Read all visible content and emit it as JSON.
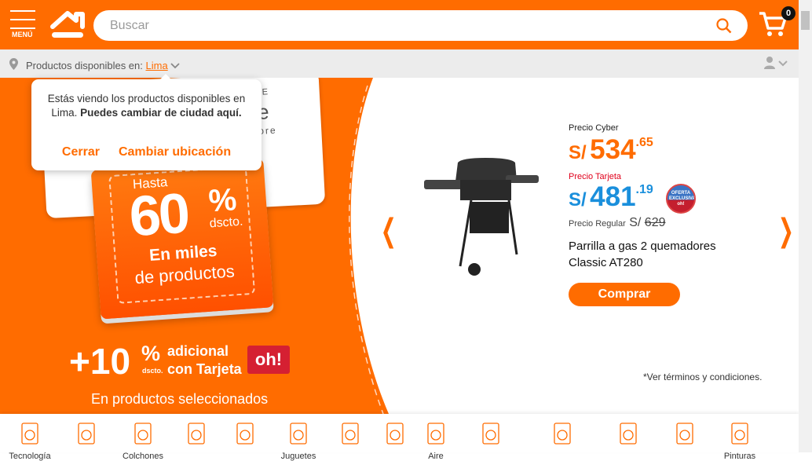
{
  "header": {
    "menu_label": "MENÚ",
    "search_placeholder": "Buscar",
    "cart_count": "0"
  },
  "location": {
    "label": "Productos disponibles en:",
    "city": "Lima"
  },
  "popup": {
    "message": "Estás viendo los productos disponibles en Lima.",
    "message_bold": "Puedes cambiar de ciudad aquí.",
    "close_label": "Cerrar",
    "change_label": "Cambiar ubicación"
  },
  "promo": {
    "hasta": "Hasta",
    "percent": "60",
    "percent_sign": "%",
    "dscto": "dscto.",
    "miles": "En miles",
    "productos": "de productos",
    "extra": "+10",
    "extra_sign": "%",
    "extra_dscto": "dscto.",
    "adicional": "adicional",
    "con_tarjeta": "con Tarjeta",
    "oh_logo": "oh!",
    "selected": "En productos seleccionados",
    "card_text_1": "N E",
    "card_text_2": "e",
    "card_text_3": "ore"
  },
  "product": {
    "cyber_label": "Precio Cyber",
    "cyber_currency": "S/",
    "cyber_int": "534",
    "cyber_dec": ".65",
    "card_label": "Precio Tarjeta",
    "card_currency": "S/",
    "card_int": "481",
    "card_dec": ".19",
    "badge": "OFERTA EXCLUSIVA oh!",
    "regular_label": "Precio Regular",
    "regular_currency": "S/",
    "regular_price": "629",
    "name": "Parrilla a gas 2 quemadores Classic AT280",
    "buy_label": "Comprar",
    "terms": "*Ver términos y condiciones."
  },
  "colors": {
    "brand": "#ff6c00",
    "card_price": "#1a8fdc",
    "card_label": "#e0001b"
  },
  "categories": [
    {
      "icon": "washing-machine-icon",
      "label": "Tecnología"
    },
    {
      "icon": "dumbbell-icon",
      "label": ""
    },
    {
      "icon": "bed-icon",
      "label": "Colchones"
    },
    {
      "icon": "wardrobe-icon",
      "label": ""
    },
    {
      "icon": "patio-umbrella-icon",
      "label": ""
    },
    {
      "icon": "bicycle-icon",
      "label": "Juguetes"
    },
    {
      "icon": "sink-icon",
      "label": ""
    },
    {
      "icon": "tile-icon",
      "label": ""
    },
    {
      "icon": "grill-icon",
      "label": "Aire"
    },
    {
      "icon": "curtain-icon",
      "label": ""
    },
    {
      "icon": "tools-icon",
      "label": ""
    },
    {
      "icon": "lamp-icon",
      "label": ""
    },
    {
      "icon": "cleaning-icon",
      "label": ""
    },
    {
      "icon": "paint-brush-icon",
      "label": "Pinturas"
    }
  ]
}
